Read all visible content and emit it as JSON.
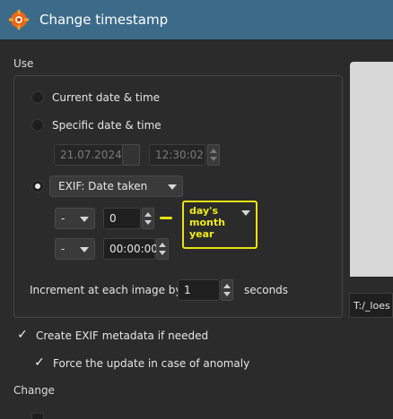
{
  "window": {
    "title": "Change timestamp"
  },
  "use_section": {
    "label": "Use",
    "options": {
      "current": "Current date & time",
      "specific": "Specific date & time",
      "exif": "EXIF: Date taken"
    },
    "selected": "exif",
    "specific_date": "21.07.2024",
    "specific_time": "12:30:02",
    "offset_days_sign": "-",
    "offset_days_value": "0",
    "offset_time_sign": "-",
    "offset_time_value": "00:00:00",
    "unit_dropdown_annotation": [
      "day's",
      "month",
      "year"
    ],
    "increment_label": "Increment at each image by",
    "increment_value": "1",
    "increment_unit": "seconds"
  },
  "preview": {
    "path": "T:/_loes"
  },
  "options": {
    "create_exif": "Create EXIF metadata if needed",
    "force_update": "Force the update in case of anomaly"
  },
  "change_section": {
    "label": "Change"
  },
  "colors": {
    "titlebar": "#3c6b8a",
    "background": "#2b2b2b",
    "annotation": "#e8e311"
  },
  "icons": {
    "app": "xnview-gear-icon",
    "dropdown": "chevron-down-icon",
    "spin": "spin-arrows-icon",
    "check": "checkmark-icon"
  }
}
